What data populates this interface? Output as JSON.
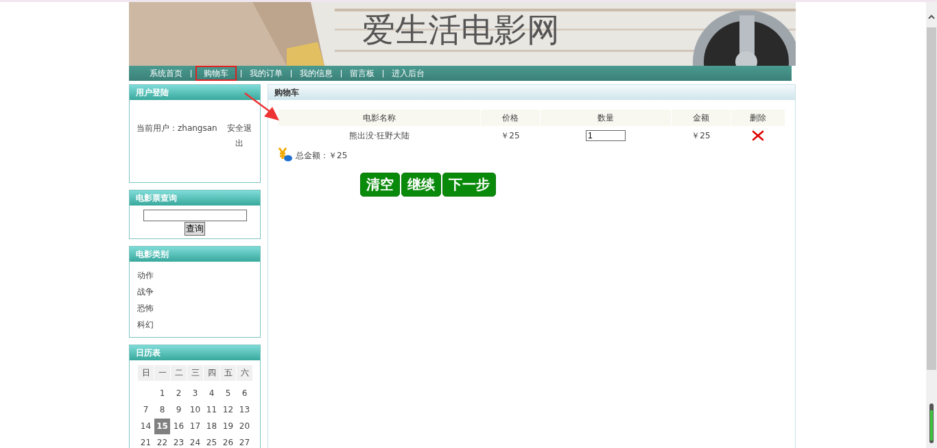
{
  "site_title": "爱生活电影网",
  "nav": [
    {
      "label": "系统首页",
      "selected": false
    },
    {
      "label": "购物车",
      "selected": true
    },
    {
      "label": "我的订单",
      "selected": false
    },
    {
      "label": "我的信息",
      "selected": false
    },
    {
      "label": "留言板",
      "selected": false
    },
    {
      "label": "进入后台",
      "selected": false
    }
  ],
  "login_panel": {
    "title": "用户登陆",
    "user_text": "当前用户：zhangsan",
    "logout": "安全退出"
  },
  "search_panel": {
    "title": "电影票查询",
    "button": "查询"
  },
  "category_panel": {
    "title": "电影类别",
    "items": [
      "动作",
      "战争",
      "恐怖",
      "科幻"
    ]
  },
  "calendar_panel": {
    "title": "日历表",
    "weekdays": [
      "日",
      "一",
      "二",
      "三",
      "四",
      "五",
      "六"
    ],
    "weeks": [
      [
        {
          "day": "1",
          "selected": false
        },
        {
          "day": "2",
          "selected": false
        },
        {
          "day": "3",
          "selected": false
        },
        {
          "day": "4",
          "selected": false
        },
        {
          "day": "5",
          "selected": false
        },
        {
          "day": "6",
          "selected": false
        }
      ],
      [
        {
          "day": "7",
          "selected": false
        },
        {
          "day": "8",
          "selected": false
        },
        {
          "day": "9",
          "selected": false
        },
        {
          "day": "10",
          "selected": false
        },
        {
          "day": "11",
          "selected": false
        },
        {
          "day": "12",
          "selected": false
        },
        {
          "day": "13",
          "selected": false
        }
      ],
      [
        {
          "day": "14",
          "selected": false
        },
        {
          "day": "15",
          "selected": true
        },
        {
          "day": "16",
          "selected": false
        },
        {
          "day": "17",
          "selected": false
        },
        {
          "day": "18",
          "selected": false
        },
        {
          "day": "19",
          "selected": false
        },
        {
          "day": "20",
          "selected": false
        }
      ],
      [
        {
          "day": "21",
          "selected": false
        },
        {
          "day": "22",
          "selected": false
        },
        {
          "day": "23",
          "selected": false
        },
        {
          "day": "24",
          "selected": false
        },
        {
          "day": "25",
          "selected": false
        },
        {
          "day": "26",
          "selected": false
        },
        {
          "day": "27",
          "selected": false
        }
      ]
    ]
  },
  "cart": {
    "title": "购物车",
    "columns": [
      "电影名称",
      "价格",
      "数量",
      "金额",
      "删除"
    ],
    "rows": [
      {
        "name": "熊出没·狂野大陆",
        "price": "￥25",
        "quantity": "1",
        "amount": "￥25"
      }
    ],
    "total": "总金额：￥25",
    "buttons": [
      "清空",
      "继续",
      "下一步"
    ]
  }
}
